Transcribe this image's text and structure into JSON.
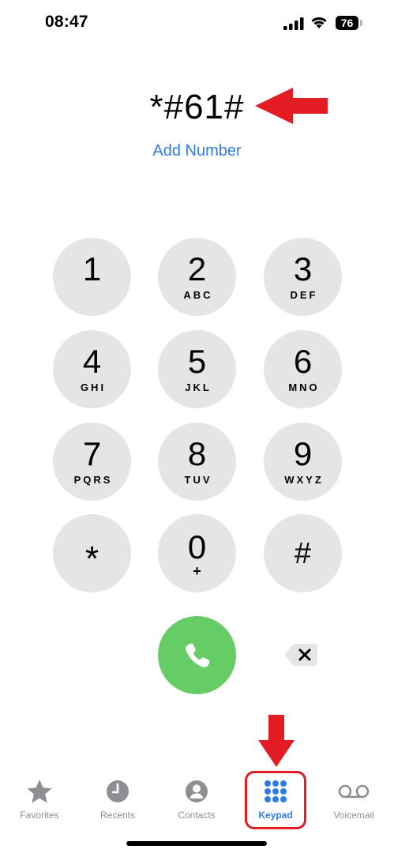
{
  "status_bar": {
    "time": "08:47",
    "battery": "76",
    "icons": [
      "signal-icon",
      "wifi-icon",
      "battery-icon"
    ]
  },
  "dialer": {
    "number": "*#61#",
    "add_number_label": "Add Number"
  },
  "keypad": {
    "keys": [
      {
        "digit": "1",
        "letters": ""
      },
      {
        "digit": "2",
        "letters": "ABC"
      },
      {
        "digit": "3",
        "letters": "DEF"
      },
      {
        "digit": "4",
        "letters": "GHI"
      },
      {
        "digit": "5",
        "letters": "JKL"
      },
      {
        "digit": "6",
        "letters": "MNO"
      },
      {
        "digit": "7",
        "letters": "PQRS"
      },
      {
        "digit": "8",
        "letters": "TUV"
      },
      {
        "digit": "9",
        "letters": "WXYZ"
      },
      {
        "digit": "*",
        "letters": ""
      },
      {
        "digit": "0",
        "letters": "+"
      },
      {
        "digit": "#",
        "letters": ""
      }
    ],
    "call_icon": "phone-icon",
    "delete_icon": "backspace-icon"
  },
  "tab_bar": {
    "tabs": [
      {
        "label": "Favorites",
        "icon": "star-icon",
        "active": false
      },
      {
        "label": "Recents",
        "icon": "clock-icon",
        "active": false
      },
      {
        "label": "Contacts",
        "icon": "person-icon",
        "active": false
      },
      {
        "label": "Keypad",
        "icon": "keypad-icon",
        "active": true
      },
      {
        "label": "Voicemail",
        "icon": "voicemail-icon",
        "active": false
      }
    ]
  },
  "colors": {
    "accent": "#2f7be0",
    "call_green": "#66cc66",
    "key_gray": "#e5e5e5",
    "annotation_red": "#e31c23",
    "inactive_tab": "#8e8e93"
  }
}
